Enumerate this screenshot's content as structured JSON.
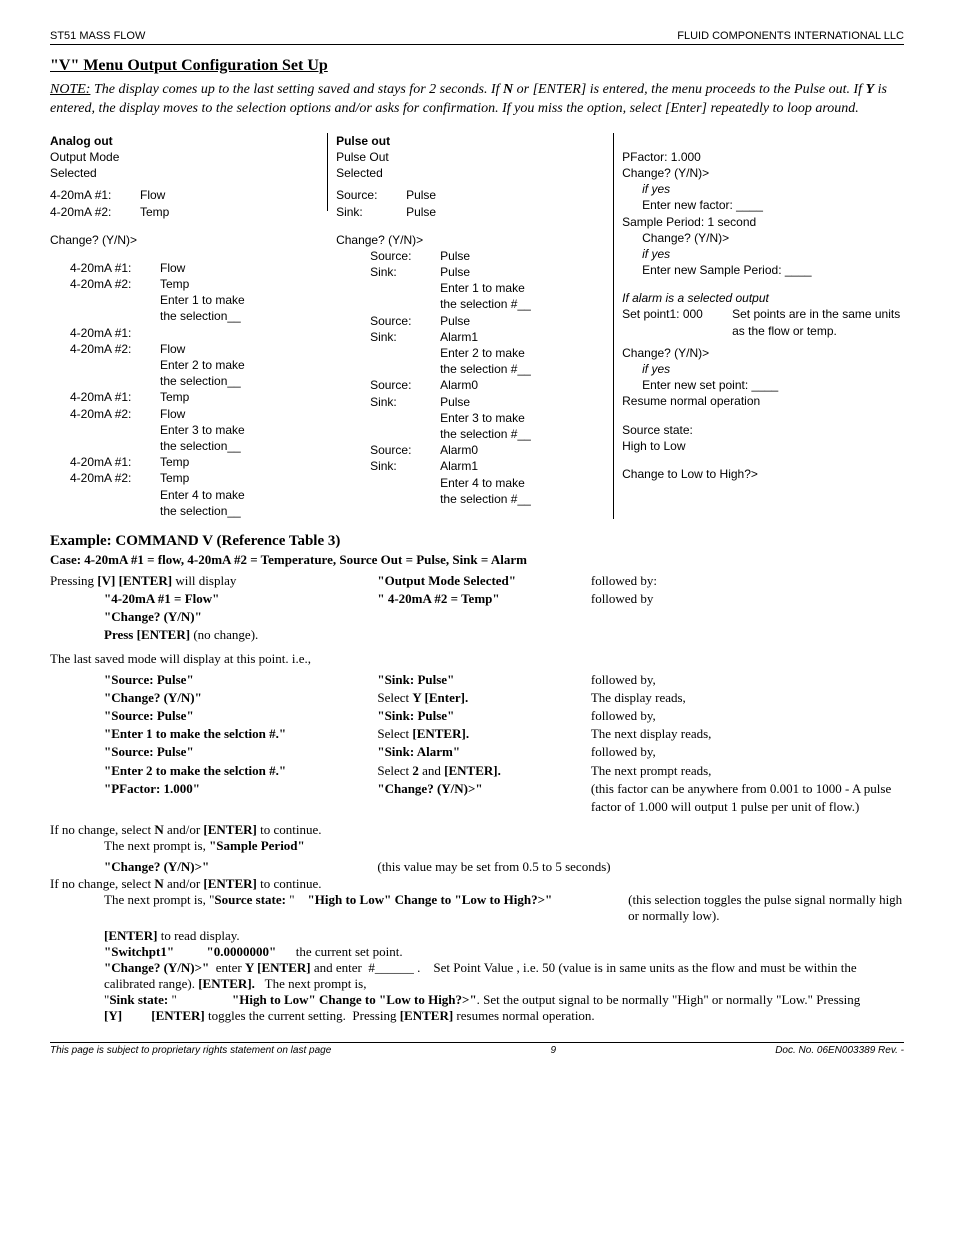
{
  "header": {
    "left": "ST51 MASS FLOW",
    "right": "FLUID COMPONENTS INTERNATIONAL LLC"
  },
  "title": "\"V\" Menu Output Configuration Set Up",
  "note": {
    "label": "NOTE:",
    "body": " The display comes up to the last setting saved and stays for 2 seconds. If ",
    "b1": "N",
    "mid": " or [ENTER] is entered, the menu proceeds to the Pulse out. If ",
    "b2": "Y",
    "tail": " is entered, the display moves to the selection options and/or asks for confirmation. If you miss the option, select [Enter] repeatedly to loop around."
  },
  "col1": {
    "h": "Analog out",
    "l1": "Output Mode",
    "l2": "Selected",
    "r1a": "4-20mA #1:",
    "r1b": "Flow",
    "r2a": "4-20mA #2:",
    "r2b": "Temp",
    "chg": "Change? (Y/N)>",
    "i1a": "4-20mA #1:",
    "i1b": "Flow",
    "i2a": "4-20mA #2:",
    "i2b": "Temp",
    "e1": "Enter 1 to make",
    "e1b": "the selection__",
    "i3a": "4-20mA #1:",
    "i4a": "4-20mA #2:",
    "i4b": "Flow",
    "e2": "Enter 2 to make",
    "e2b": "the selection__",
    "i5a": "4-20mA #1:",
    "i5b": "Temp",
    "i6a": "4-20mA #2:",
    "i6b": "Flow",
    "e3": "Enter 3 to make",
    "e3b": "the selection__",
    "i7a": "4-20mA #1:",
    "i7b": "Temp",
    "i8a": "4-20mA #2:",
    "i8b": "Temp",
    "e4": "Enter 4 to make",
    "e4b": "the selection__"
  },
  "col2": {
    "h": "Pulse out",
    "l1": "Pulse Out",
    "l2": "Selected",
    "r1a": "Source:",
    "r1b": "Pulse",
    "r2a": "Sink:",
    "r2b": "Pulse",
    "chg": "Change? (Y/N)>",
    "s1a": "Source:",
    "s1b": "Pulse",
    "s2a": "Sink:",
    "s2b": "Pulse",
    "e1": "Enter 1 to make",
    "e1b": "the selection #__",
    "s3a": "Source:",
    "s3b": "Pulse",
    "s4a": "Sink:",
    "s4b": "Alarm1",
    "e2": "Enter 2 to make",
    "e2b": "the selection #__",
    "s5a": "Source:",
    "s5b": "Alarm0",
    "s6a": "Sink:",
    "s6b": "Pulse",
    "e3": "Enter 3 to make",
    "e3b": "the selection #__",
    "s7a": "Source:",
    "s7b": "Alarm0",
    "s8a": "Sink:",
    "s8b": "Alarm1",
    "e4": "Enter 4 to make",
    "e4b": "the selection #__"
  },
  "col3": {
    "pf": "PFactor: 1.000",
    "chg": "Change? (Y/N)>",
    "ify": "if yes",
    "enf": "Enter new factor: ____",
    "sp": "Sample Period: 1 second",
    "chg2": "Change? (Y/N)>",
    "ify2": "if yes",
    "ensp": "Enter new Sample Period: ____",
    "alarm": "If alarm is a selected output",
    "sp1": "Set point1: 000",
    "spnote": "Set points are in the same units as the flow or temp.",
    "chg3": "Change? (Y/N)>",
    "ify3": "if yes",
    "ensp3": "Enter new set point: ____",
    "res": "Resume normal operation",
    "ss": "Source state:",
    "hl": "High to Low",
    "cth": "Change to Low to High?>"
  },
  "ex": {
    "title": "Example: COMMAND V (Reference Table 3)",
    "case": "Case: 4-20mA #1 = flow,  4-20mA #2 = Temperature,          Source Out = Pulse,          Sink = Alarm",
    "p1c1": "Pressing [V] [ENTER] will display",
    "p1c2": "\"Output Mode Selected\"",
    "p1c3": "followed by:",
    "p2c1": "\"4-20mA #1 = Flow\"",
    "p2c2": "\" 4-20mA #2 = Temp\"",
    "p2c3": "followed by",
    "p3": "\"Change? (Y/N)\"",
    "p4a": "Press [ENTER]",
    "p4b": " (no change).",
    "lastsaved": "The last saved mode will display at this point.  i.e.,",
    "r1c1": "\"Source: Pulse\"",
    "r1c2": "\"Sink: Pulse\"",
    "r1c3": "followed by,",
    "r2c1": "\"Change? (Y/N)\"",
    "r2c2": "Select Y [Enter].",
    "r2c3": "The display reads,",
    "r3c1": "\"Source: Pulse\"",
    "r3c2": "\"Sink: Pulse\"",
    "r3c3": "followed by,",
    "r4c1": "\"Enter 1 to make the selction #.\"",
    "r4c2": "Select  [ENTER].",
    "r4c3": "The next display reads,",
    "r5c1": "\"Source: Pulse\"",
    "r5c2": "\"Sink: Alarm\"",
    "r5c3": "followed by,",
    "r6c1": "\"Enter 2 to make the selction #.\"",
    "r6c2": "Select 2 and [ENTER].",
    "r6c3": "The next prompt reads,",
    "r7c1": "\"PFactor: 1.000\"",
    "r7c2": "\"Change? (Y/N)>\"",
    "r7c3": "(this factor can be anywhere from 0.001 to 1000 -  A pulse factor of 1.000 will output 1 pulse per unit of flow.)",
    "nc1": "If no change, select N and/or [ENTER] to continue.",
    "np1": "The next prompt is, \"Sample Period\"",
    "np2a": "\"Change? (Y/N)>\"",
    "np2b": "(this value may be set from 0.5 to 5 seconds)",
    "nc2": "If no change, select N and/or [ENTER] to continue.",
    "np3a": "The next prompt is,  \"Source state: \"    \"High to Low\" Change to \"Low to High?>\"",
    "np3b": "(this selection toggles the pulse signal normally high or normally low).",
    "er": "[ENTER] to read display.",
    "sw": "\"Switchpt1\"          \"0.0000000\"",
    "swb": "the current set point.",
    "chgline": "\"Change? (Y/N)>\"  enter Y [ENTER] and enter  #______ .    Set Point Value , i.e. 50 (value is in same units as the flow and must be within the calibrated range). [ENTER].   The next prompt is,",
    "sink": "\"Sink state: \"                 \"High to Low\" Change to \"Low to High?>\". Set the output signal to be normally \"High\" or normally \"Low.\" Pressing [Y]         [ENTER] toggles the current setting.  Pressing [ENTER] resumes normal operation."
  },
  "footer": {
    "left": "This page is subject to proprietary rights statement on last page",
    "mid": "9",
    "right": "Doc. No. 06EN003389 Rev. -"
  }
}
